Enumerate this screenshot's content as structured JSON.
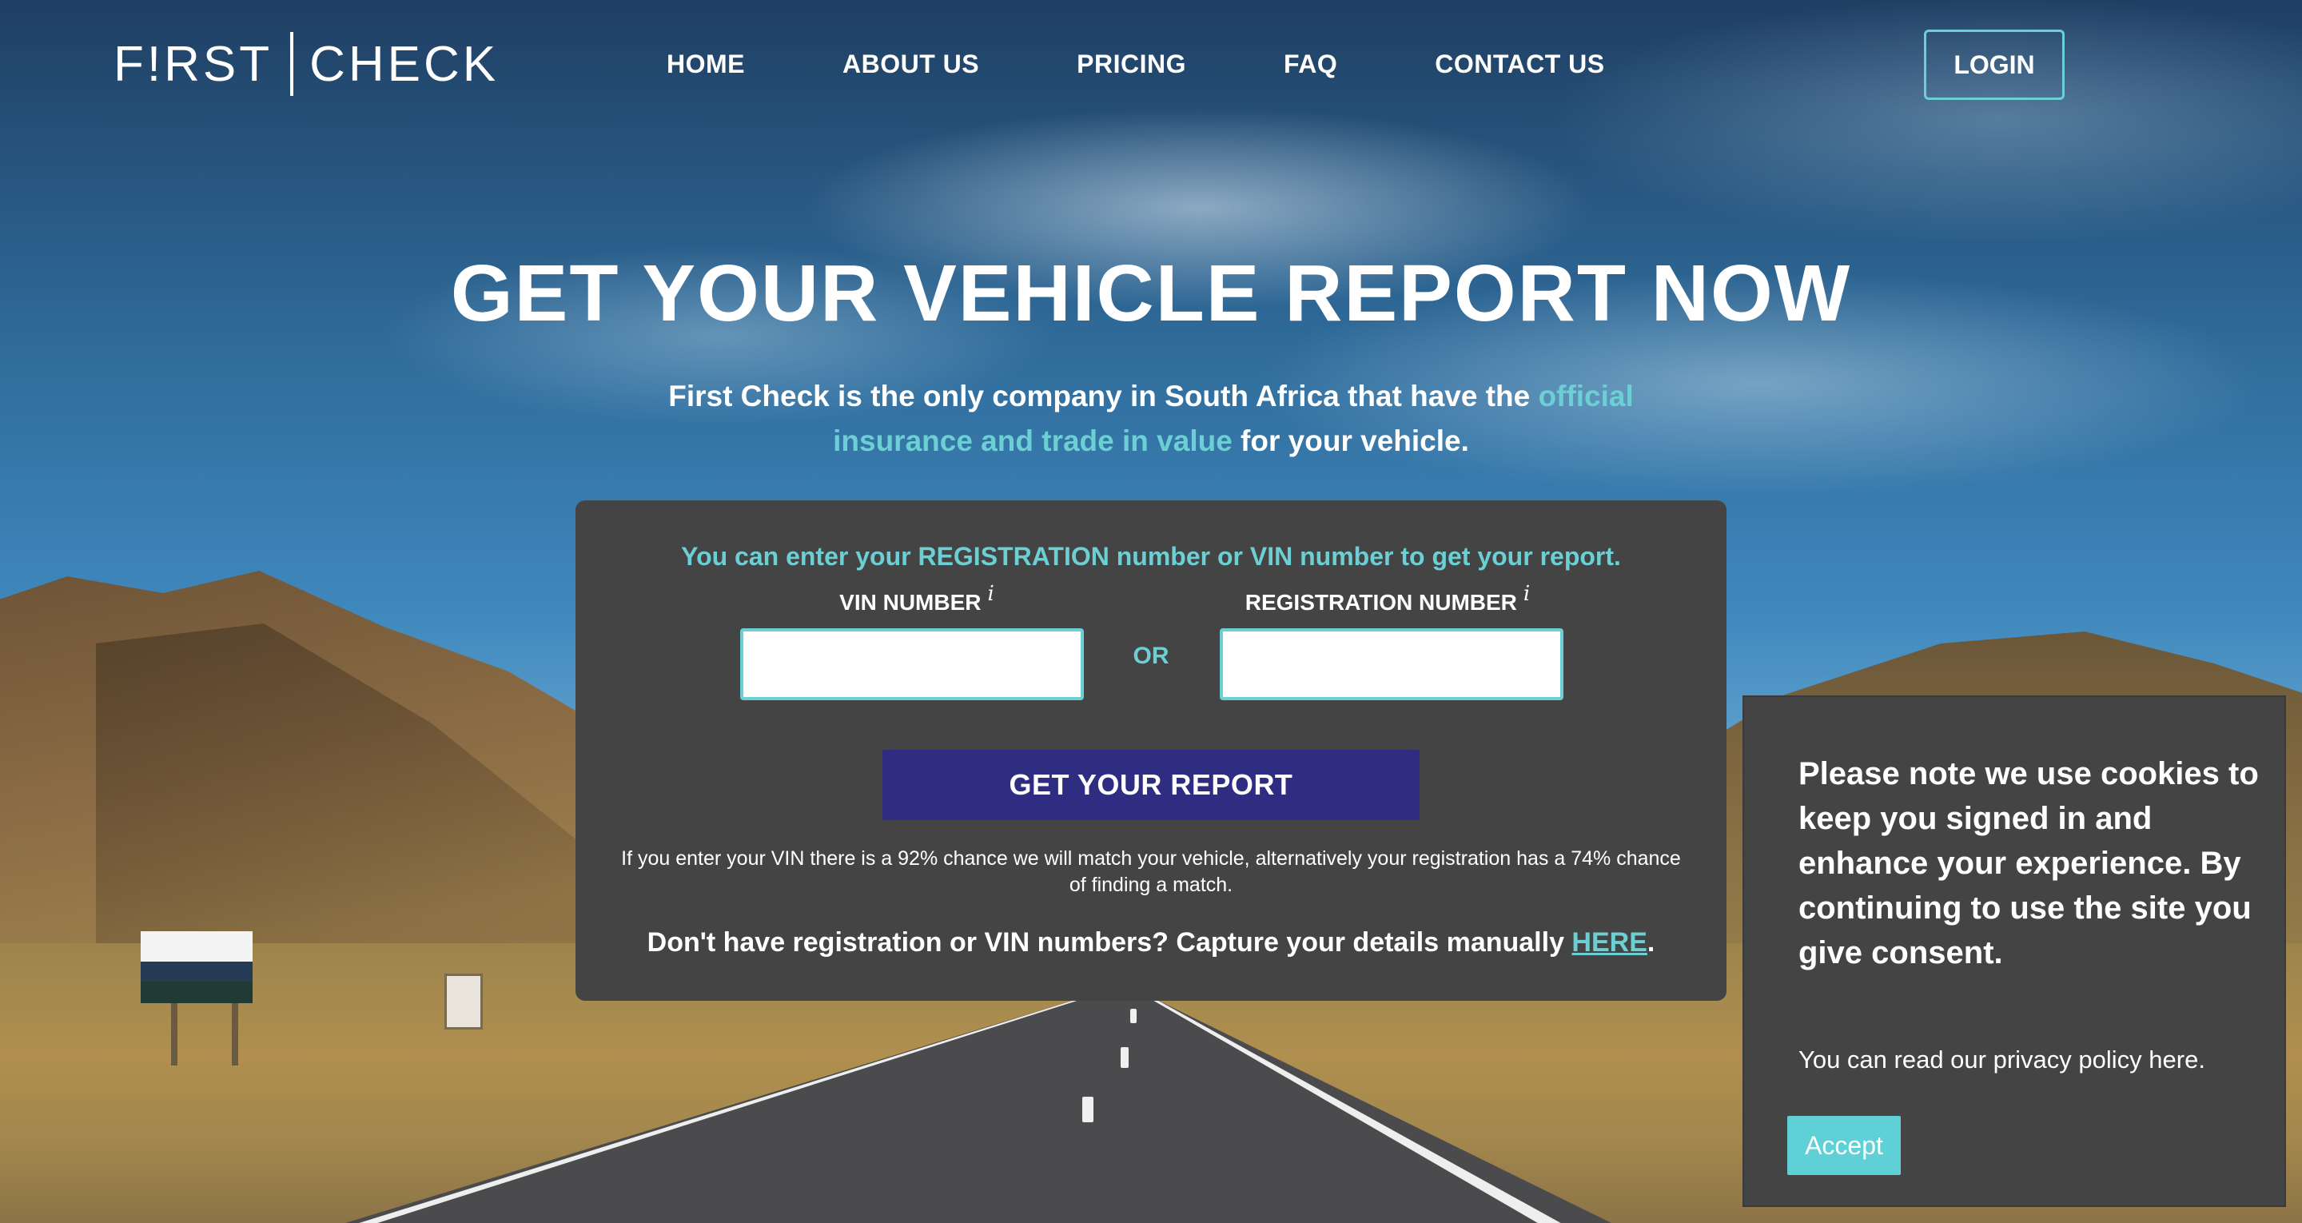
{
  "header": {
    "logo_left": "F!RST",
    "logo_right": "CHECK",
    "nav": {
      "home": "HOME",
      "about": "ABOUT US",
      "pricing": "PRICING",
      "faq": "FAQ",
      "contact": "CONTACT US"
    },
    "login_label": "LOGIN"
  },
  "hero": {
    "title": "GET YOUR VEHICLE REPORT NOW",
    "subtitle_prefix": "First Check is the only company in South Africa that have the ",
    "subtitle_accent": "official insurance and trade in value",
    "subtitle_suffix": " for your vehicle."
  },
  "form": {
    "intro": "You can enter your REGISTRATION number or VIN number to get your report.",
    "vin_label": "VIN NUMBER",
    "vin_info": "i",
    "vin_value": "",
    "or_label": "OR",
    "reg_label": "REGISTRATION NUMBER",
    "reg_info": "i",
    "reg_value": "",
    "submit_label": "GET YOUR REPORT",
    "note": "If you enter your VIN there is a 92% chance we will match your vehicle, alternatively your registration has a 74% chance of finding a match.",
    "manual_prefix": "Don't have registration or VIN numbers? Capture your details manually ",
    "manual_link": "HERE",
    "manual_suffix": "."
  },
  "cookie": {
    "message": "Please note we use cookies to keep you signed in and enhance your experience. By continuing to use the site you give consent.",
    "privacy": "You can read our privacy policy here.",
    "accept_label": "Accept"
  },
  "colors": {
    "accent": "#6ccfd3",
    "button": "#2e2d82",
    "panel": "#444444"
  }
}
